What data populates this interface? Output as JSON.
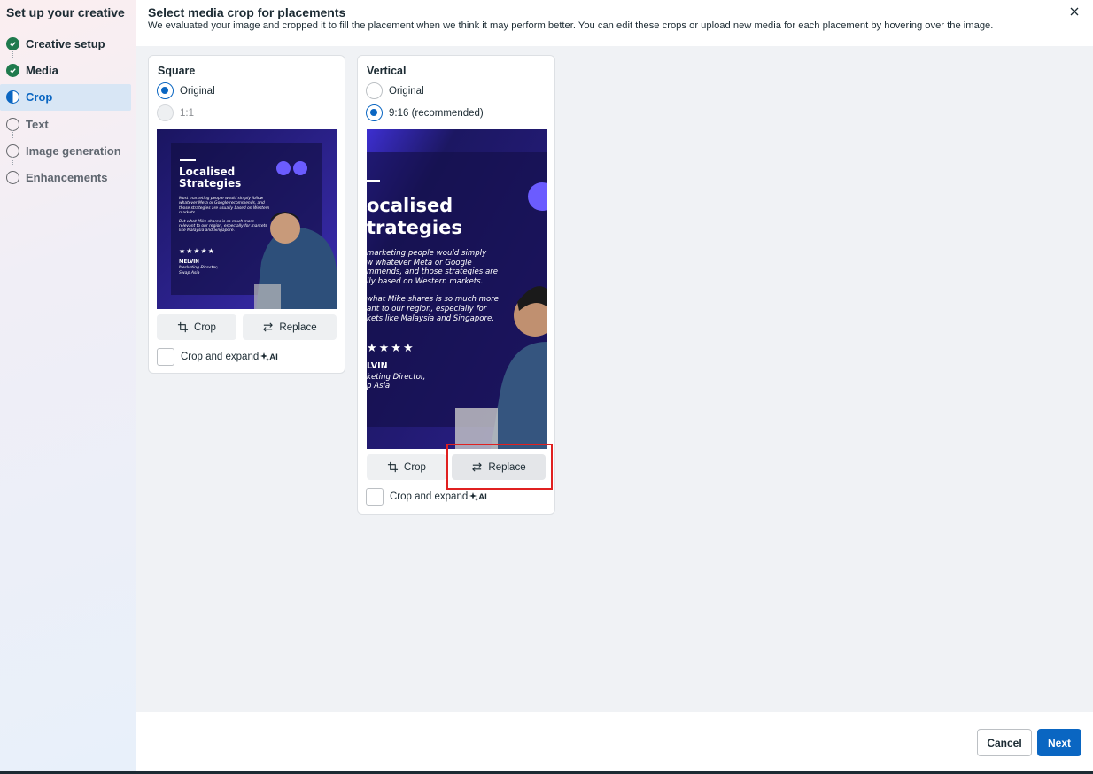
{
  "sidebar": {
    "title": "Set up your creative",
    "steps": [
      {
        "label": "Creative setup",
        "state": "done"
      },
      {
        "label": "Media",
        "state": "done"
      },
      {
        "label": "Crop",
        "state": "active"
      },
      {
        "label": "Text",
        "state": "todo"
      },
      {
        "label": "Image generation",
        "state": "todo"
      },
      {
        "label": "Enhancements",
        "state": "todo"
      }
    ]
  },
  "header": {
    "title": "Select media crop for placements",
    "subtitle": "We evaluated your image and cropped it to fill the placement when we think it may perform better. You can edit these crops or upload new media for each placement by hovering over the image."
  },
  "cards": [
    {
      "title": "Square",
      "options": [
        {
          "label": "Original",
          "selected": true,
          "disabled": false
        },
        {
          "label": "1:1",
          "selected": false,
          "disabled": true
        }
      ],
      "crop_label": "Crop",
      "replace_label": "Replace",
      "expand_label": "Crop and expand",
      "ai_label": "AI"
    },
    {
      "title": "Vertical",
      "options": [
        {
          "label": "Original",
          "selected": false,
          "disabled": false
        },
        {
          "label": "9:16 (recommended)",
          "selected": true,
          "disabled": false
        }
      ],
      "crop_label": "Crop",
      "replace_label": "Replace",
      "expand_label": "Crop and expand",
      "ai_label": "AI"
    }
  ],
  "preview": {
    "heading_line1": "Localised",
    "heading_line2": "Strategies",
    "para1": "Most marketing people would simply follow whatever Meta or Google recommends, and those strategies are usually based on Western markets.",
    "para2": "But what Mike shares is so much more relevant to our region, especially for markets like Malaysia and Singapore.",
    "stars": "★★★★★",
    "name": "MELVIN",
    "role": "Marketing Director,",
    "company": "Swap Asia",
    "v_heading1": "ocalised",
    "v_heading2": "trategies",
    "v_para1a": "marketing people would simply",
    "v_para1b": "w whatever Meta or Google",
    "v_para1c": "mmends, and those strategies are",
    "v_para1d": "lly based on Western markets.",
    "v_para2a": "what Mike shares is so much more",
    "v_para2b": "ant to our region, especially for",
    "v_para2c": "kets like Malaysia and Singapore.",
    "v_stars": "★★★★",
    "v_name": "LVIN",
    "v_role": "keting Director,",
    "v_company": "p Asia"
  },
  "footer": {
    "cancel_label": "Cancel",
    "next_label": "Next"
  },
  "colors": {
    "accent": "#0a66c2",
    "done_green": "#1f7a4d",
    "highlight_red": "#e02020",
    "preview_purple": "#2a1f7a"
  }
}
